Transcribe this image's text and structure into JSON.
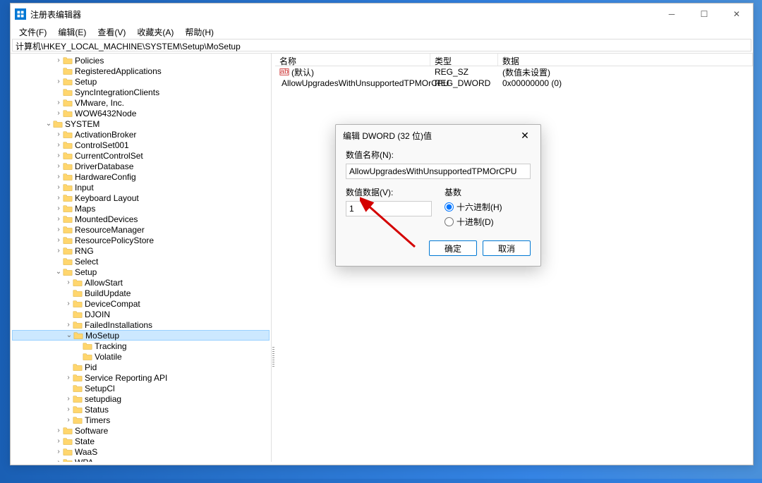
{
  "title": "注册表编辑器",
  "menu": [
    "文件(F)",
    "编辑(E)",
    "查看(V)",
    "收藏夹(A)",
    "帮助(H)"
  ],
  "path": "计算机\\HKEY_LOCAL_MACHINE\\SYSTEM\\Setup\\MoSetup",
  "tree": [
    {
      "d": 3,
      "c": "closed",
      "l": "Policies"
    },
    {
      "d": 3,
      "c": "",
      "l": "RegisteredApplications"
    },
    {
      "d": 3,
      "c": "closed",
      "l": "Setup"
    },
    {
      "d": 3,
      "c": "",
      "l": "SyncIntegrationClients"
    },
    {
      "d": 3,
      "c": "closed",
      "l": "VMware, Inc."
    },
    {
      "d": 3,
      "c": "closed",
      "l": "WOW6432Node"
    },
    {
      "d": 2,
      "c": "open",
      "l": "SYSTEM"
    },
    {
      "d": 3,
      "c": "closed",
      "l": "ActivationBroker"
    },
    {
      "d": 3,
      "c": "closed",
      "l": "ControlSet001"
    },
    {
      "d": 3,
      "c": "closed",
      "l": "CurrentControlSet"
    },
    {
      "d": 3,
      "c": "closed",
      "l": "DriverDatabase"
    },
    {
      "d": 3,
      "c": "closed",
      "l": "HardwareConfig"
    },
    {
      "d": 3,
      "c": "closed",
      "l": "Input"
    },
    {
      "d": 3,
      "c": "closed",
      "l": "Keyboard Layout"
    },
    {
      "d": 3,
      "c": "closed",
      "l": "Maps"
    },
    {
      "d": 3,
      "c": "closed",
      "l": "MountedDevices"
    },
    {
      "d": 3,
      "c": "closed",
      "l": "ResourceManager"
    },
    {
      "d": 3,
      "c": "closed",
      "l": "ResourcePolicyStore"
    },
    {
      "d": 3,
      "c": "closed",
      "l": "RNG"
    },
    {
      "d": 3,
      "c": "",
      "l": "Select"
    },
    {
      "d": 3,
      "c": "open",
      "l": "Setup"
    },
    {
      "d": 4,
      "c": "closed",
      "l": "AllowStart"
    },
    {
      "d": 4,
      "c": "",
      "l": "BuildUpdate"
    },
    {
      "d": 4,
      "c": "closed",
      "l": "DeviceCompat"
    },
    {
      "d": 4,
      "c": "",
      "l": "DJOIN"
    },
    {
      "d": 4,
      "c": "closed",
      "l": "FailedInstallations"
    },
    {
      "d": 4,
      "c": "open",
      "l": "MoSetup",
      "sel": true
    },
    {
      "d": 5,
      "c": "",
      "l": "Tracking"
    },
    {
      "d": 5,
      "c": "",
      "l": "Volatile"
    },
    {
      "d": 4,
      "c": "",
      "l": "Pid"
    },
    {
      "d": 4,
      "c": "closed",
      "l": "Service Reporting API"
    },
    {
      "d": 4,
      "c": "",
      "l": "SetupCl"
    },
    {
      "d": 4,
      "c": "closed",
      "l": "setupdiag"
    },
    {
      "d": 4,
      "c": "closed",
      "l": "Status"
    },
    {
      "d": 4,
      "c": "closed",
      "l": "Timers"
    },
    {
      "d": 3,
      "c": "closed",
      "l": "Software"
    },
    {
      "d": 3,
      "c": "closed",
      "l": "State"
    },
    {
      "d": 3,
      "c": "closed",
      "l": "WaaS"
    },
    {
      "d": 3,
      "c": "closed",
      "l": "WPA"
    }
  ],
  "list_headers": {
    "name": "名称",
    "type": "类型",
    "data": "数据"
  },
  "list_rows": [
    {
      "icon": "ab",
      "name": "(默认)",
      "type": "REG_SZ",
      "data": "(数值未设置)"
    },
    {
      "icon": "bin",
      "name": "AllowUpgradesWithUnsupportedTPMOrCPU",
      "type": "REG_DWORD",
      "data": "0x00000000 (0)"
    }
  ],
  "dialog": {
    "title": "编辑 DWORD (32 位)值",
    "name_label": "数值名称(N):",
    "name_value": "AllowUpgradesWithUnsupportedTPMOrCPU",
    "data_label": "数值数据(V):",
    "data_value": "1",
    "base_label": "基数",
    "radio_hex": "十六进制(H)",
    "radio_dec": "十进制(D)",
    "ok": "确定",
    "cancel": "取消"
  }
}
